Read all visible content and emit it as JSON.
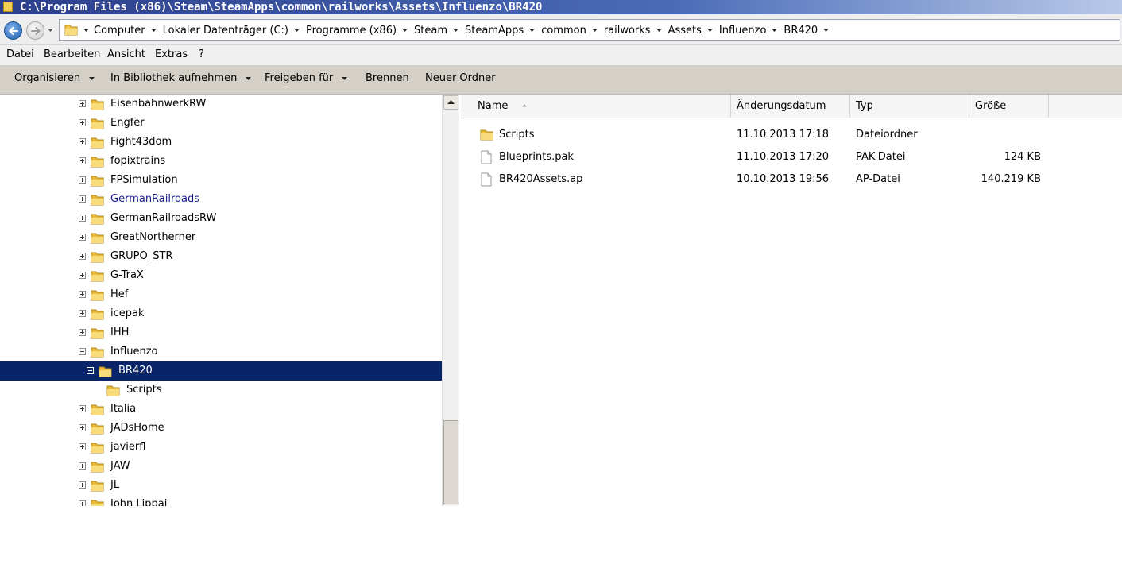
{
  "window": {
    "title": "C:\\Program Files (x86)\\Steam\\SteamApps\\common\\railworks\\Assets\\Influenzo\\BR420"
  },
  "icons": {
    "back": "back-arrow-icon",
    "forward": "forward-arrow-icon",
    "folder": "folder-icon",
    "file": "file-icon",
    "sort": "sort-ascending-icon",
    "dropdown": "chevron-down-icon"
  },
  "address": {
    "crumbs": [
      "Computer",
      "Lokaler Datenträger (C:)",
      "Programme (x86)",
      "Steam",
      "SteamApps",
      "common",
      "railworks",
      "Assets",
      "Influenzo",
      "BR420"
    ]
  },
  "menu": [
    "Datei",
    "Bearbeiten",
    "Ansicht",
    "Extras",
    "?"
  ],
  "toolbar": {
    "organize": "Organisieren",
    "library": "In Bibliothek aufnehmen",
    "share": "Freigeben für",
    "burn": "Brennen",
    "new_folder": "Neuer Ordner"
  },
  "tree": [
    {
      "label": "EisenbahnwerkRW",
      "expander": "plus"
    },
    {
      "label": "Engfer",
      "expander": "plus"
    },
    {
      "label": "Fight43dom",
      "expander": "plus"
    },
    {
      "label": "fopixtrains",
      "expander": "plus"
    },
    {
      "label": "FPSimulation",
      "expander": "plus"
    },
    {
      "label": "GermanRailroads",
      "expander": "plus",
      "hover": true
    },
    {
      "label": "GermanRailroadsRW",
      "expander": "plus"
    },
    {
      "label": "GreatNortherner",
      "expander": "plus"
    },
    {
      "label": "GRUPO_STR",
      "expander": "plus"
    },
    {
      "label": "G-TraX",
      "expander": "plus"
    },
    {
      "label": "Hef",
      "expander": "plus"
    },
    {
      "label": "icepak",
      "expander": "plus"
    },
    {
      "label": "IHH",
      "expander": "plus"
    },
    {
      "label": "Influenzo",
      "expander": "minus"
    },
    {
      "label": "BR420",
      "expander": "minus",
      "selected": true,
      "level": 1
    },
    {
      "label": "Scripts",
      "expander": "none",
      "level": 2
    },
    {
      "label": "Italia",
      "expander": "plus"
    },
    {
      "label": "JADsHome",
      "expander": "plus"
    },
    {
      "label": "javierfl",
      "expander": "plus"
    },
    {
      "label": "JAW",
      "expander": "plus"
    },
    {
      "label": "JL",
      "expander": "plus"
    },
    {
      "label": "John Lippai",
      "expander": "plus"
    }
  ],
  "columns": {
    "name": "Name",
    "date": "Änderungsdatum",
    "type": "Typ",
    "size": "Größe"
  },
  "files": [
    {
      "name": "Scripts",
      "date": "11.10.2013 17:18",
      "type": "Dateiordner",
      "size": "",
      "kind": "folder"
    },
    {
      "name": "Blueprints.pak",
      "date": "11.10.2013 17:20",
      "type": "PAK-Datei",
      "size": "124 KB",
      "kind": "file"
    },
    {
      "name": "BR420Assets.ap",
      "date": "10.10.2013 19:56",
      "type": "AP-Datei",
      "size": "140.219 KB",
      "kind": "file"
    }
  ]
}
